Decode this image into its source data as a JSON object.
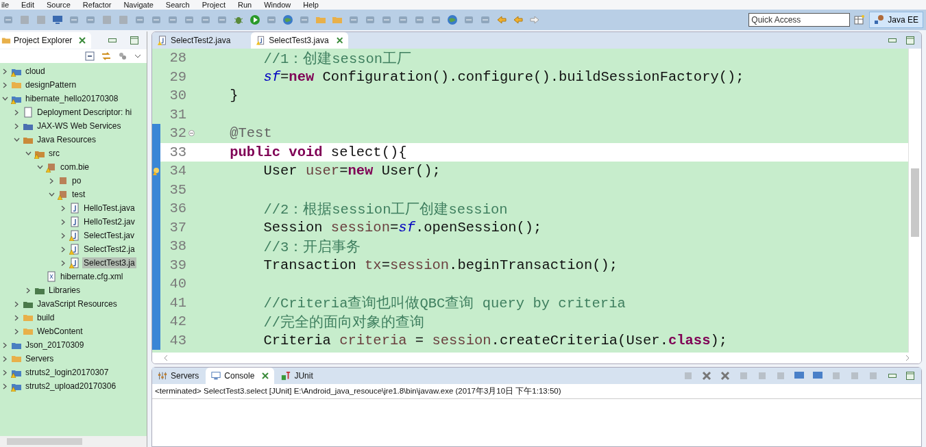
{
  "menu": [
    "ile",
    "Edit",
    "Source",
    "Refactor",
    "Navigate",
    "Search",
    "Project",
    "Run",
    "Window",
    "Help"
  ],
  "toolbar": {
    "quick_access": {
      "placeholder": "Quick Access"
    },
    "perspective": {
      "label": "Java EE",
      "selected": true
    }
  },
  "project_explorer": {
    "title": "Project Explorer",
    "items": [
      {
        "label": "cloud",
        "kind": "project",
        "warning": true,
        "expanded": false,
        "selected": false
      },
      {
        "label": "designPattern",
        "kind": "folder",
        "warning": false,
        "expanded": false,
        "selected": false
      },
      {
        "label": "hibernate_hello20170308",
        "kind": "project",
        "warning": true,
        "expanded": true,
        "selected": false,
        "children": [
          {
            "label": "Deployment Descriptor: hi",
            "kind": "descriptor",
            "warning": false,
            "expanded": false,
            "selected": false
          },
          {
            "label": "JAX-WS Web Services",
            "kind": "webservice",
            "warning": false,
            "expanded": false,
            "selected": false
          },
          {
            "label": "Java Resources",
            "kind": "resources",
            "warning": false,
            "expanded": true,
            "selected": false,
            "children": [
              {
                "label": "src",
                "kind": "source",
                "warning": true,
                "expanded": true,
                "selected": false,
                "children": [
                  {
                    "label": "com.bie",
                    "kind": "package",
                    "warning": true,
                    "expanded": true,
                    "selected": false,
                    "children": [
                      {
                        "label": "po",
                        "kind": "package",
                        "warning": false,
                        "expanded": false,
                        "selected": false
                      },
                      {
                        "label": "test",
                        "kind": "package",
                        "warning": true,
                        "expanded": true,
                        "selected": false,
                        "children": [
                          {
                            "label": "HelloTest.java",
                            "kind": "javafile",
                            "warning": false,
                            "expanded": false,
                            "selected": false
                          },
                          {
                            "label": "HelloTest2.jav",
                            "kind": "javafile",
                            "warning": false,
                            "expanded": false,
                            "selected": false
                          },
                          {
                            "label": "SelectTest.jav",
                            "kind": "javafile",
                            "warning": true,
                            "expanded": false,
                            "selected": false
                          },
                          {
                            "label": "SelectTest2.ja",
                            "kind": "javafile",
                            "warning": true,
                            "expanded": false,
                            "selected": false
                          },
                          {
                            "label": "SelectTest3.ja",
                            "kind": "javafile",
                            "warning": true,
                            "expanded": false,
                            "selected": true
                          }
                        ]
                      }
                    ]
                  },
                  {
                    "label": "hibernate.cfg.xml",
                    "kind": "xmlfile",
                    "warning": false,
                    "selected": false
                  }
                ]
              },
              {
                "label": "Libraries",
                "kind": "library",
                "warning": false,
                "expanded": false,
                "selected": false
              }
            ]
          },
          {
            "label": "JavaScript Resources",
            "kind": "library",
            "warning": false,
            "expanded": false,
            "selected": false
          },
          {
            "label": "build",
            "kind": "folder",
            "warning": false,
            "expanded": false,
            "selected": false
          },
          {
            "label": "WebContent",
            "kind": "folder",
            "warning": false,
            "expanded": false,
            "selected": false
          }
        ]
      },
      {
        "label": "Json_20170309",
        "kind": "project",
        "warning": false,
        "expanded": false,
        "selected": false
      },
      {
        "label": "Servers",
        "kind": "folder",
        "warning": false,
        "expanded": false,
        "selected": false
      },
      {
        "label": "struts2_login20170307",
        "kind": "project",
        "warning": true,
        "expanded": false,
        "selected": false
      },
      {
        "label": "struts2_upload20170306",
        "kind": "project",
        "warning": true,
        "expanded": false,
        "selected": false
      }
    ]
  },
  "editor": {
    "tabs": [
      {
        "label": "SelectTest2.java",
        "selected": false,
        "warning": true
      },
      {
        "label": "SelectTest3.java",
        "selected": true,
        "warning": true
      }
    ],
    "lines": [
      {
        "number": "28",
        "range": false,
        "current": false,
        "fold": false,
        "marker": false,
        "segments": [
          {
            "kind": "comment",
            "text": "        //1：创建sesson工厂"
          }
        ]
      },
      {
        "number": "29",
        "range": false,
        "current": false,
        "fold": false,
        "marker": false,
        "segments": [
          {
            "kind": "field",
            "text": "        sf"
          },
          {
            "kind": "plain",
            "text": "="
          },
          {
            "kind": "keyword",
            "text": "new"
          },
          {
            "kind": "plain",
            "text": " Configuration().configure().buildSessionFactory();"
          }
        ]
      },
      {
        "number": "30",
        "range": false,
        "current": false,
        "fold": false,
        "marker": false,
        "segments": [
          {
            "kind": "plain",
            "text": "    }"
          }
        ]
      },
      {
        "number": "31",
        "range": false,
        "current": false,
        "fold": false,
        "marker": false
      },
      {
        "number": "32",
        "range": true,
        "current": false,
        "fold": true,
        "marker": false,
        "segments": [
          {
            "kind": "annotation",
            "text": "    @Test"
          }
        ]
      },
      {
        "number": "33",
        "range": true,
        "current": true,
        "fold": false,
        "marker": false,
        "segments": [
          {
            "kind": "keyword",
            "text": "    public"
          },
          {
            "kind": "keyword",
            "text": " void"
          },
          {
            "kind": "plain",
            "text": " select(){"
          }
        ]
      },
      {
        "number": "34",
        "range": true,
        "current": false,
        "fold": false,
        "marker": true,
        "segments": [
          {
            "kind": "plain",
            "text": "        User "
          },
          {
            "kind": "local",
            "text": "user"
          },
          {
            "kind": "plain",
            "text": "="
          },
          {
            "kind": "keyword",
            "text": "new"
          },
          {
            "kind": "plain",
            "text": " User();"
          }
        ]
      },
      {
        "number": "35",
        "range": true,
        "current": false,
        "fold": false,
        "marker": false
      },
      {
        "number": "36",
        "range": true,
        "current": false,
        "fold": false,
        "marker": false,
        "segments": [
          {
            "kind": "comment",
            "text": "        //2：根据session工厂创建session"
          }
        ]
      },
      {
        "number": "37",
        "range": true,
        "current": false,
        "fold": false,
        "marker": false,
        "segments": [
          {
            "kind": "plain",
            "text": "        Session "
          },
          {
            "kind": "local",
            "text": "session"
          },
          {
            "kind": "plain",
            "text": "="
          },
          {
            "kind": "field",
            "text": "sf"
          },
          {
            "kind": "plain",
            "text": ".openSession();"
          }
        ]
      },
      {
        "number": "38",
        "range": true,
        "current": false,
        "fold": false,
        "marker": false,
        "segments": [
          {
            "kind": "comment",
            "text": "        //3：开启事务"
          }
        ]
      },
      {
        "number": "39",
        "range": true,
        "current": false,
        "fold": false,
        "marker": false,
        "segments": [
          {
            "kind": "plain",
            "text": "        Transaction "
          },
          {
            "kind": "local",
            "text": "tx"
          },
          {
            "kind": "plain",
            "text": "="
          },
          {
            "kind": "local",
            "text": "session"
          },
          {
            "kind": "plain",
            "text": ".beginTransaction();"
          }
        ]
      },
      {
        "number": "40",
        "range": true,
        "current": false,
        "fold": false,
        "marker": false
      },
      {
        "number": "41",
        "range": true,
        "current": false,
        "fold": false,
        "marker": false,
        "segments": [
          {
            "kind": "comment",
            "text": "        //Criteria查询也叫做QBC查询 query by criteria"
          }
        ]
      },
      {
        "number": "42",
        "range": true,
        "current": false,
        "fold": false,
        "marker": false,
        "segments": [
          {
            "kind": "comment",
            "text": "        //完全的面向对象的查询"
          }
        ]
      },
      {
        "number": "43",
        "range": true,
        "current": false,
        "fold": false,
        "marker": false,
        "segments": [
          {
            "kind": "plain",
            "text": "        Criteria "
          },
          {
            "kind": "local",
            "text": "criteria"
          },
          {
            "kind": "plain",
            "text": " = "
          },
          {
            "kind": "local",
            "text": "session"
          },
          {
            "kind": "plain",
            "text": ".createCriteria(User."
          },
          {
            "kind": "keyword",
            "text": "class"
          },
          {
            "kind": "plain",
            "text": ");"
          }
        ]
      }
    ]
  },
  "console": {
    "tabs": [
      {
        "label": "Servers",
        "kind": "servers",
        "selected": false
      },
      {
        "label": "Console",
        "kind": "console",
        "selected": true
      },
      {
        "label": "JUnit",
        "kind": "junit",
        "selected": false
      }
    ],
    "status": "<terminated> SelectTest3.select [JUnit] E:\\Android_java_resouce\\jre1.8\\bin\\javaw.exe (2017年3月10日 下午1:13:50)"
  }
}
